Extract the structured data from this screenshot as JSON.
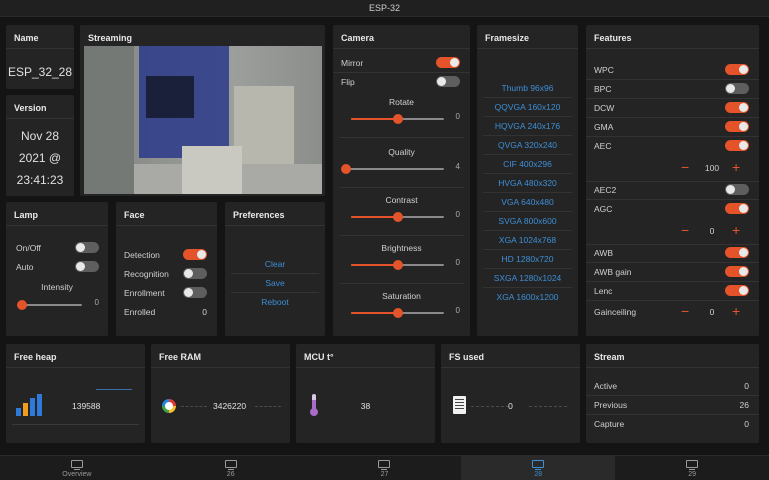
{
  "title": "ESP-32",
  "name_card": {
    "title": "Name",
    "value": "ESP_32_28"
  },
  "version_card": {
    "title": "Version",
    "line1": "Nov 28",
    "line2": "2021 @",
    "line3": "23:41:23"
  },
  "streaming": {
    "title": "Streaming"
  },
  "camera": {
    "title": "Camera",
    "mirror_label": "Mirror",
    "mirror_on": true,
    "flip_label": "Flip",
    "flip_on": false,
    "sliders": [
      {
        "label": "Rotate",
        "value": "0",
        "fraction": 0.5
      },
      {
        "label": "Quality",
        "value": "4",
        "fraction": 0.0
      },
      {
        "label": "Contrast",
        "value": "0",
        "fraction": 0.5
      },
      {
        "label": "Brightness",
        "value": "0",
        "fraction": 0.5
      },
      {
        "label": "Saturation",
        "value": "0",
        "fraction": 0.5
      }
    ]
  },
  "framesize": {
    "title": "Framesize",
    "items": [
      "Thumb 96x96",
      "QQVGA 160x120",
      "HQVGA 240x176",
      "QVGA 320x240",
      "CIF 400x296",
      "HVGA 480x320",
      "VGA 640x480",
      "SVGA 800x600",
      "XGA 1024x768",
      "HD 1280x720",
      "SXGA 1280x1024",
      "XGA 1600x1200"
    ]
  },
  "features": {
    "title": "Features",
    "wpc": "WPC",
    "bpc": "BPC",
    "dcw": "DCW",
    "gma": "GMA",
    "aec": "AEC",
    "aec_value": "100",
    "aec2": "AEC2",
    "agc": "AGC",
    "agc_value": "0",
    "awb": "AWB",
    "awb_gain": "AWB gain",
    "lenc": "Lenc",
    "gainceiling": "Gainceiling",
    "gainceiling_value": "0",
    "minus": "−",
    "plus": "+"
  },
  "lamp": {
    "title": "Lamp",
    "onoff": "On/Off",
    "auto": "Auto",
    "intensity": "Intensity",
    "intensity_value": "0",
    "intensity_fraction": 0.0
  },
  "face": {
    "title": "Face",
    "detection": "Detection",
    "recognition": "Recognition",
    "enrollment": "Enrollment",
    "enrolled": "Enrolled",
    "enrolled_value": "0"
  },
  "preferences": {
    "title": "Preferences",
    "clear": "Clear",
    "save": "Save",
    "reboot": "Reboot"
  },
  "free_heap": {
    "title": "Free heap",
    "value": "139588"
  },
  "free_ram": {
    "title": "Free RAM",
    "value": "3426220"
  },
  "mcu": {
    "title": "MCU t°",
    "value": "38"
  },
  "fs_used": {
    "title": "FS used",
    "value": "0"
  },
  "stream": {
    "title": "Stream",
    "active": "Active",
    "active_value": "0",
    "previous": "Previous",
    "previous_value": "26",
    "capture": "Capture",
    "capture_value": "0"
  },
  "tabs": [
    "Overview",
    "26",
    "27",
    "28",
    "29"
  ],
  "active_tab": 3,
  "accent": "#e4532a",
  "link_color": "#3d8fd6"
}
